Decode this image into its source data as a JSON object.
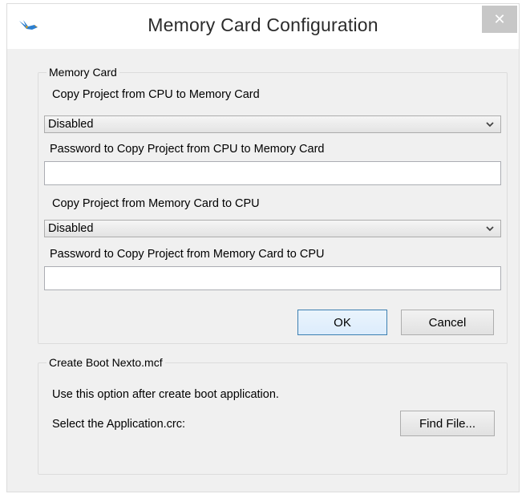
{
  "window": {
    "title": "Memory Card Configuration",
    "close_glyph": "✕",
    "app_icon": "bird-logo-icon"
  },
  "memory_card": {
    "legend": "Memory Card",
    "copy_cpu_to_card_label": "Copy Project from CPU to Memory Card",
    "copy_cpu_to_card_value": "Disabled",
    "password_cpu_to_card_label": "Password to Copy Project from CPU to Memory Card",
    "password_cpu_to_card_value": "",
    "copy_card_to_cpu_label": "Copy Project from Memory Card to CPU",
    "copy_card_to_cpu_value": "Disabled",
    "password_card_to_cpu_label": "Password to Copy Project from Memory Card to CPU",
    "password_card_to_cpu_value": "",
    "ok_label": "OK",
    "cancel_label": "Cancel"
  },
  "boot": {
    "legend": "Create Boot Nexto.mcf",
    "info_text": "Use this option after create boot application.",
    "select_label": "Select the Application.crc:",
    "find_file_label": "Find File..."
  },
  "colors": {
    "window_bg": "#f0f0f0",
    "close_button_bg": "#c7c7c7",
    "default_button_border": "#3c7fb1"
  }
}
